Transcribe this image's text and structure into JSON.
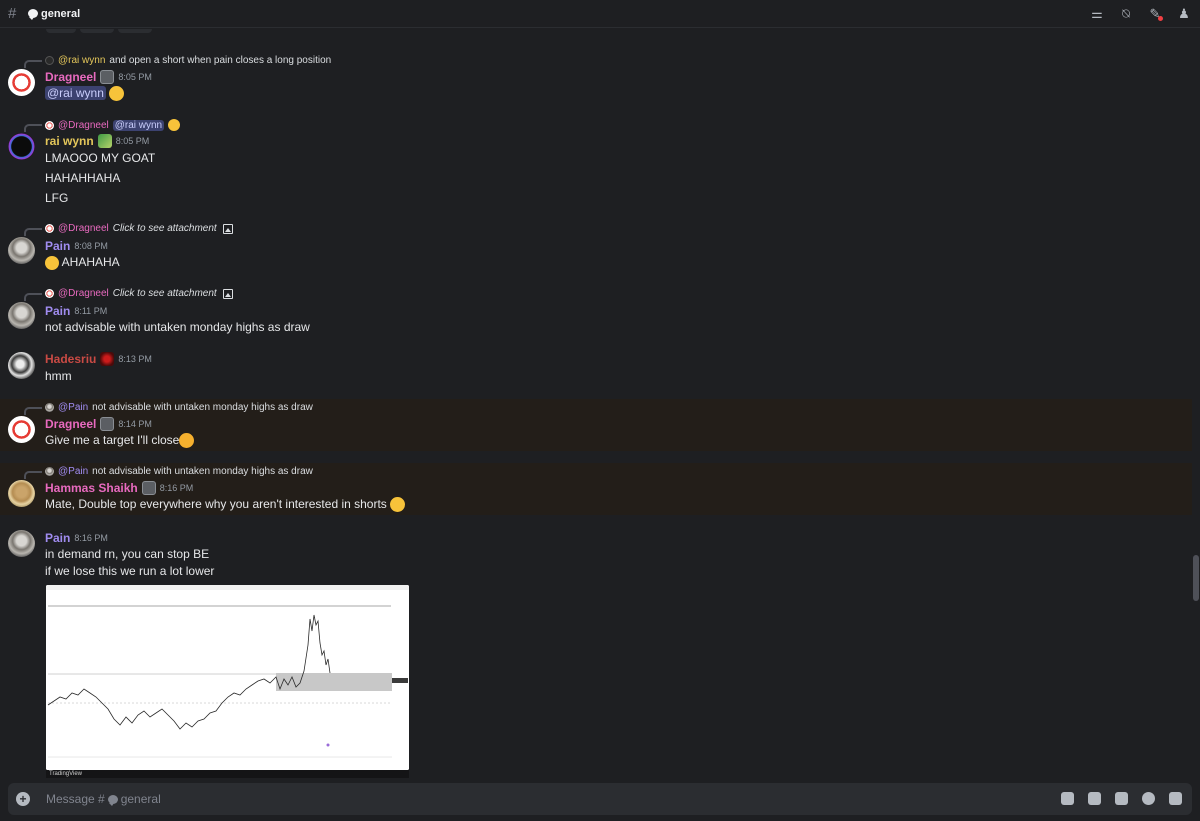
{
  "header": {
    "hash": "#",
    "channel": "general",
    "icons": [
      "threads-icon",
      "mute-bell-icon",
      "pinned-icon",
      "member-list-icon"
    ]
  },
  "composer": {
    "placeholder_prefix": "Message #",
    "placeholder_channel": "general",
    "icons": [
      "gift-icon",
      "gif-icon",
      "sticker-icon",
      "emoji-icon",
      "apps-icon"
    ]
  },
  "messages": [
    {
      "reply": {
        "name": "@rai wynn",
        "text": "and open a short when pain closes a long position",
        "color": "#e3c65a"
      },
      "author": "Dragneel",
      "author_color": "#e86abf",
      "time": "8:05 PM",
      "mention": "@rai wynn"
    },
    {
      "reply": {
        "name": "@Dragneel",
        "mention": "@rai wynn",
        "color": "#e86abf"
      },
      "author": "rai wynn",
      "author_color": "#e3c65a",
      "time": "8:05 PM",
      "lines": [
        "LMAOOO MY GOAT",
        "HAHAHHAHA",
        "LFG"
      ]
    },
    {
      "reply": {
        "name": "@Dragneel",
        "text": "Click to see attachment",
        "color": "#e86abf"
      },
      "author": "Pain",
      "author_color": "#a08cf0",
      "time": "8:08 PM",
      "lines": [
        "AHAHAHA"
      ]
    },
    {
      "reply": {
        "name": "@Dragneel",
        "text": "Click to see attachment",
        "color": "#e86abf"
      },
      "author": "Pain",
      "author_color": "#a08cf0",
      "time": "8:11 PM",
      "lines": [
        "not advisable with untaken monday highs as draw"
      ]
    },
    {
      "author": "Hadesriu",
      "author_color": "#c94a44",
      "time": "8:13 PM",
      "lines": [
        "hmm"
      ]
    },
    {
      "reply": {
        "name": "@Pain",
        "text": "not advisable with untaken monday highs as draw",
        "color": "#a08cf0"
      },
      "author": "Dragneel",
      "author_color": "#e86abf",
      "time": "8:14 PM",
      "lines": [
        "Give me a target I'll close"
      ]
    },
    {
      "reply": {
        "name": "@Pain",
        "text": "not advisable with untaken monday highs as draw",
        "color": "#a08cf0"
      },
      "author": "Hammas Shaikh",
      "author_color": "#e86abf",
      "time": "8:16 PM",
      "lines": [
        "Mate, Double top everywhere why you aren't interested in shorts"
      ]
    },
    {
      "author": "Pain",
      "author_color": "#a08cf0",
      "time": "8:16 PM",
      "lines": [
        "in demand rn, you can stop BE",
        "if we lose this we run a lot lower"
      ],
      "attachment_footer": "TradingView"
    }
  ],
  "colors": {
    "background": "#1e1f22",
    "highlight_row": "#231e19",
    "mention_bg": "#3c4270"
  }
}
